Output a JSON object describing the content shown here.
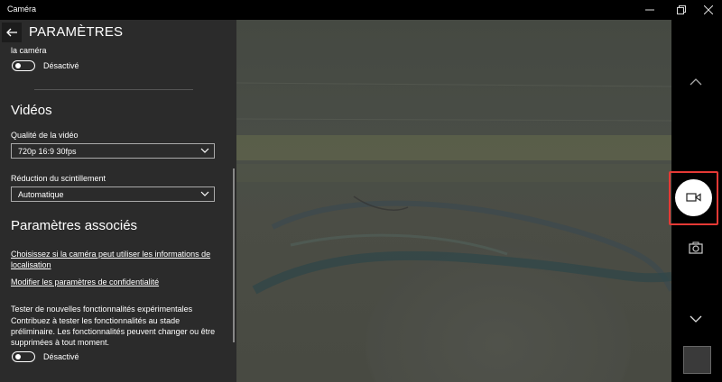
{
  "window": {
    "title": "Caméra"
  },
  "settings": {
    "header": "PARAMÈTRES",
    "prev_caption": "la caméra",
    "prev_toggle_state": "Désactivé",
    "videos_heading": "Vidéos",
    "quality_label": "Qualité de la vidéo",
    "quality_value": "720p 16:9 30fps",
    "flicker_label": "Réduction du scintillement",
    "flicker_value": "Automatique",
    "related_heading": "Paramètres associés",
    "location_link": "Choisissez si la caméra peut utiliser les informations de localisation",
    "privacy_link": "Modifier les paramètres de confidentialité",
    "experimental_title": "Tester de nouvelles fonctionnalités expérimentales",
    "experimental_desc": "Contribuez à tester les fonctionnalités au stade préliminaire. Les fonctionnalités peuvent changer ou être supprimées à tout moment.",
    "experimental_toggle_state": "Désactivé"
  },
  "icons": {
    "back": "back-arrow-icon",
    "video_mode": "video-camera-icon",
    "photo_mode": "camera-icon",
    "up": "chevron-up-icon",
    "down": "chevron-down-icon"
  },
  "colors": {
    "highlight": "#e53935",
    "panel_bg": "#2b2b2b"
  }
}
